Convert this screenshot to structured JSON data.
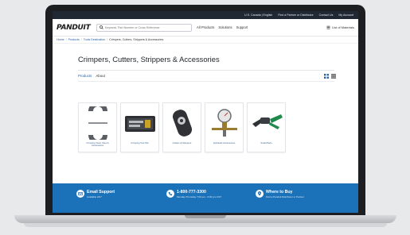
{
  "topbar": {
    "region": "U.S. Canada | English",
    "find_partner": "Find a Partner or Distributor",
    "contact": "Contact Us",
    "account": "My Account"
  },
  "header": {
    "logo_text": "PANDUIT",
    "search_placeholder": "Keyword, Part Number or Cross Reference",
    "nav": [
      "All Products",
      "Solutions",
      "Support"
    ],
    "documents": "List of Materials"
  },
  "breadcrumb": [
    "Home",
    "Products",
    "Tools Destination",
    "Crimpers, Cutters, Strippers & Accessories"
  ],
  "page": {
    "title": "Crimpers, Cutters, Strippers & Accessories",
    "tabs": [
      "Products",
      "About"
    ],
    "active_tab": "Products"
  },
  "cards": [
    {
      "label": "Crimping Tools, Dies & Accessories",
      "icon": "crimping-die-icon"
    },
    {
      "label": "Crimping Tool Kits",
      "icon": "tool-kit-case-icon"
    },
    {
      "label": "Cutters & Strippers",
      "icon": "cable-stripper-icon"
    },
    {
      "label": "Hydraulic Accessories",
      "icon": "hydraulic-pump-gauge-icon"
    },
    {
      "label": "Small Parts",
      "icon": "hydraulic-crimper-icon"
    }
  ],
  "footer": {
    "email": {
      "title": "Email Support",
      "sub": "Available 24/7"
    },
    "phone": {
      "title": "1-800-777-3300",
      "sub": "Monday-Thursday 7:00 am - 6:00 pm CST"
    },
    "where": {
      "title": "Where to Buy",
      "sub": "Find a Panduit Distributor or Partner"
    }
  },
  "colors": {
    "topbar": "#1f2833",
    "link": "#2b63a6",
    "footer": "#1c72b8"
  }
}
